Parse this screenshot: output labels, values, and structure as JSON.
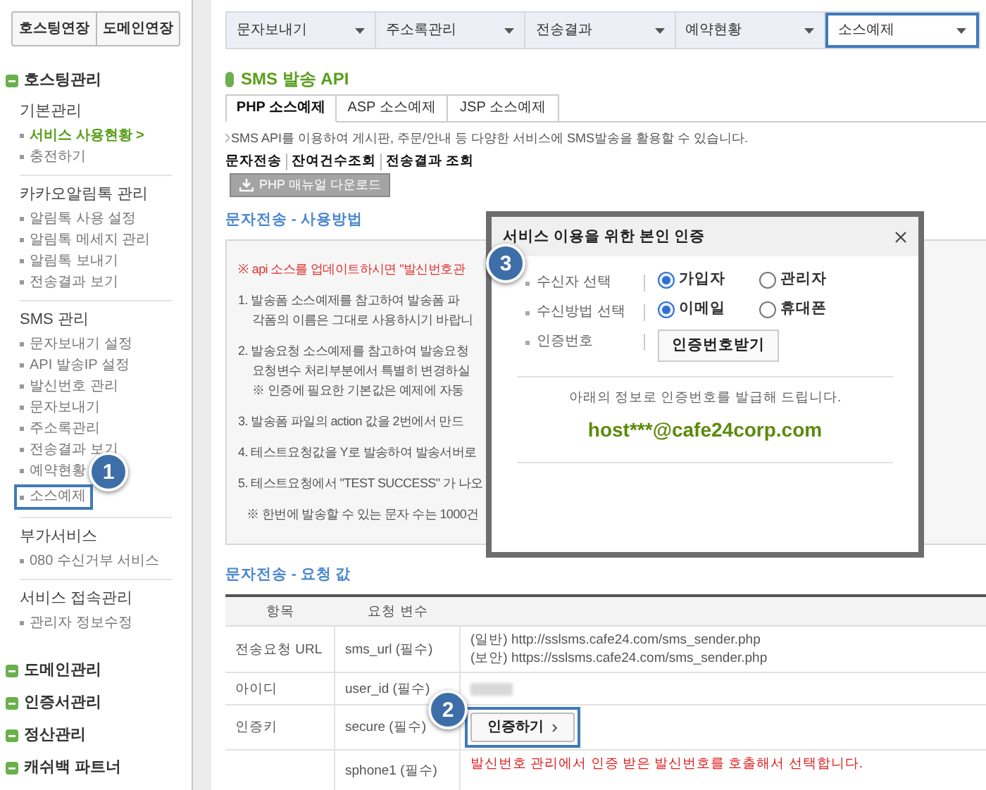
{
  "sidebar": {
    "top_buttons": [
      "호스팅연장",
      "도메인연장"
    ],
    "menu": {
      "title": "호스팅관리",
      "groups": [
        {
          "title": "기본관리",
          "items": [
            {
              "label": "서비스 사용현황 >",
              "selected": true
            },
            {
              "label": "충전하기",
              "selected": false
            }
          ]
        },
        {
          "title": "카카오알림톡 관리",
          "items": [
            {
              "label": "알림톡 사용 설정",
              "selected": false
            },
            {
              "label": "알림톡 메세지 관리",
              "selected": false
            },
            {
              "label": "알림톡 보내기",
              "selected": false
            },
            {
              "label": "전송결과 보기",
              "selected": false
            }
          ]
        },
        {
          "title": "SMS 관리",
          "items": [
            {
              "label": "문자보내기 설정",
              "selected": false
            },
            {
              "label": "API 발송IP 설정",
              "selected": false
            },
            {
              "label": "발신번호 관리",
              "selected": false
            },
            {
              "label": "문자보내기",
              "selected": false
            },
            {
              "label": "주소록관리",
              "selected": false
            },
            {
              "label": "전송결과 보기",
              "selected": false
            },
            {
              "label": "예약현황",
              "selected": false
            },
            {
              "label": "소스예제",
              "selected": false,
              "callout": "1"
            }
          ]
        },
        {
          "title": "부가서비스",
          "items": [
            {
              "label": "080 수신거부 서비스",
              "selected": false
            }
          ]
        },
        {
          "title": "서비스 접속관리",
          "items": [
            {
              "label": "관리자 정보수정",
              "selected": false
            }
          ]
        }
      ]
    },
    "sections": [
      "도메인관리",
      "인증서관리",
      "정산관리",
      "캐쉬백 파트너"
    ]
  },
  "nav_dropdowns": [
    {
      "label": "문자보내기",
      "selected": false
    },
    {
      "label": "주소록관리",
      "selected": false
    },
    {
      "label": "전송결과",
      "selected": false
    },
    {
      "label": "예약현황",
      "selected": false
    },
    {
      "label": "소스예제",
      "selected": true
    }
  ],
  "page_title": "SMS 발송 API",
  "tabs": [
    {
      "label": "PHP 소스예제",
      "selected": true
    },
    {
      "label": "ASP 소스예제",
      "selected": false
    },
    {
      "label": "JSP 소스예제",
      "selected": false
    }
  ],
  "description": "SMS API를 이용하여 게시판, 주문/안내 등 다양한 서비스에 SMS발송을 활용할 수 있습니다.",
  "links": [
    "문자전송",
    "잔여건수조회",
    "전송결과 조회"
  ],
  "download_button": "PHP 매뉴얼 다운로드",
  "usage": {
    "heading": "문자전송 - 사용방법",
    "notice": "※ api 소스를 업데이트하시면 \"발신번호관",
    "steps": [
      [
        "1. 발송폼 소스예제를 참고하여 발송폼 파",
        "각폼의 이름은 그대로 사용하시기 바랍니"
      ],
      [
        "2. 발송요청 소스예제를 참고하여 발송요청",
        "요청변수 처리부분에서 특별히 변경하실",
        "※ 인증에 필요한 기본값은 예제에 자동"
      ],
      [
        "3. 발송폼 파일의 action 값을 2번에서 만드"
      ],
      [
        "4. 테스트요청값을 Y로 발송하여 발송서버로"
      ],
      [
        "5. 테스트요청에서 \"TEST SUCCESS\" 가 나오"
      ]
    ],
    "footnote": "※ 한번에 발송할 수 있는 문자 수는 1000건"
  },
  "request": {
    "heading": "문자전송 - 요청 값",
    "columns": [
      "항목",
      "요청 변수"
    ],
    "rows": [
      {
        "kind": "text",
        "item": "전송요청 URL",
        "variable": "sms_url (필수)",
        "lines": [
          "(일반) http://sslsms.cafe24.com/sms_sender.php",
          "(보안) https://sslsms.cafe24.com/sms_sender.php"
        ]
      },
      {
        "kind": "redacted",
        "item": "아이디",
        "variable": "user_id (필수)"
      },
      {
        "kind": "button",
        "item": "인증키",
        "variable": "secure (필수)",
        "button": "인증하기",
        "callout": "2"
      },
      {
        "kind": "note",
        "variable": "sphone1 (필수)",
        "lines": [
          "발신번호 관리에서 인증 받은 발신번호를 호출해서 선택합니다."
        ]
      }
    ]
  },
  "dialog": {
    "title": "서비스 이용을 위한 본인 인증",
    "callout": "3",
    "fields": [
      {
        "kind": "radio",
        "label": "수신자 선택",
        "options": [
          {
            "label": "가입자",
            "selected": true
          },
          {
            "label": "관리자",
            "selected": false
          }
        ]
      },
      {
        "kind": "radio",
        "label": "수신방법 선택",
        "options": [
          {
            "label": "이메일",
            "selected": true
          },
          {
            "label": "휴대폰",
            "selected": false
          }
        ]
      },
      {
        "kind": "button",
        "label": "인증번호",
        "button": "인증번호받기"
      }
    ],
    "info": "아래의 정보로 인증번호를 발급해 드립니다.",
    "email": "host***@cafe24corp.com"
  }
}
